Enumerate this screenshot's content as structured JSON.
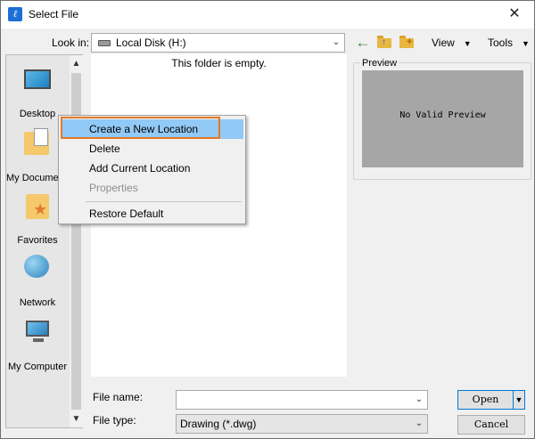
{
  "window": {
    "title": "Select File",
    "close_glyph": "✕",
    "app_icon_glyph": "ℓ"
  },
  "toolbar": {
    "look_in_label": "Look in:",
    "look_in_value": "Local Disk (H:)",
    "views_label": "View",
    "tools_label": "Tools",
    "caret": "▼",
    "combo_caret": "⌄"
  },
  "places": {
    "items": [
      {
        "label": "Desktop",
        "icon": "desktop-icon"
      },
      {
        "label": "My Documents",
        "icon": "my-documents-icon"
      },
      {
        "label": "Favorites",
        "icon": "favorites-icon"
      },
      {
        "label": "Network",
        "icon": "network-icon"
      },
      {
        "label": "My Computer",
        "icon": "my-computer-icon"
      }
    ],
    "scroll_up_glyph": "▲",
    "scroll_down_glyph": "▼"
  },
  "file_list": {
    "empty_message": "This folder is empty."
  },
  "preview": {
    "label": "Preview",
    "message": "No Valid Preview"
  },
  "context_menu": {
    "items": [
      {
        "label": "Create a New Location",
        "highlighted": true
      },
      {
        "label": "Delete"
      },
      {
        "label": "Add Current Location"
      },
      {
        "label": "Properties",
        "disabled": true
      },
      {
        "label": "Restore Default"
      }
    ]
  },
  "bottom": {
    "file_name_label": "File name:",
    "file_name_value": "",
    "file_type_label": "File type:",
    "file_type_value": "Drawing (*.dwg)",
    "open_label": "Open",
    "cancel_label": "Cancel"
  },
  "colors": {
    "accent": "#0078d7",
    "menu_highlight": "#91c9f7",
    "focus_frame": "#e87722",
    "preview_background": "#a6a6a6"
  }
}
